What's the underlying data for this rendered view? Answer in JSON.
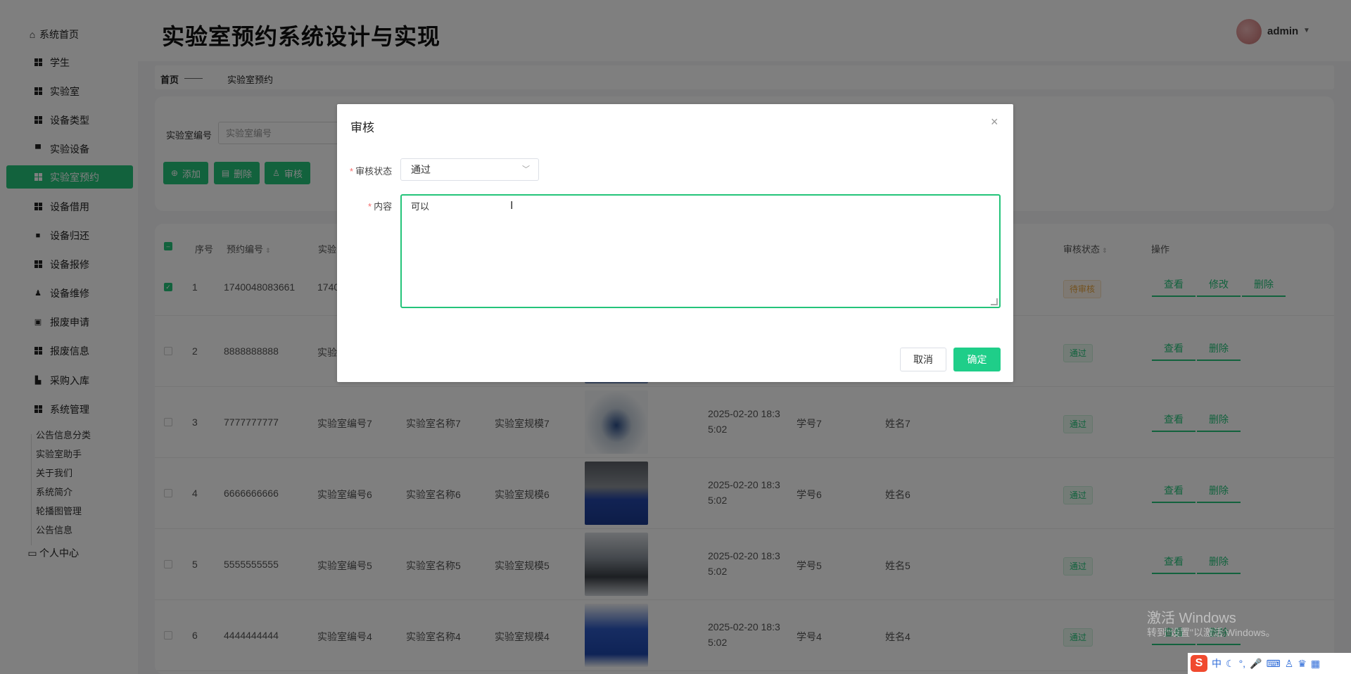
{
  "app": {
    "title": "实验室预约系统设计与实现"
  },
  "user": {
    "name": "admin"
  },
  "sidebar": {
    "home": "系统首页",
    "items": [
      {
        "label": "学生",
        "icon": "grid-icon"
      },
      {
        "label": "实验室",
        "icon": "grid-icon"
      },
      {
        "label": "设备类型",
        "icon": "grid-icon"
      },
      {
        "label": "实验设备",
        "icon": "monitor-icon"
      },
      {
        "label": "实验室预约",
        "icon": "grid-icon",
        "active": true
      },
      {
        "label": "设备借用",
        "icon": "grid-icon"
      },
      {
        "label": "设备归还",
        "icon": "briefcase-icon"
      },
      {
        "label": "设备报修",
        "icon": "grid-icon"
      },
      {
        "label": "设备维修",
        "icon": "person-icon"
      },
      {
        "label": "报废申请",
        "icon": "clipboard-icon"
      },
      {
        "label": "报废信息",
        "icon": "grid-icon"
      },
      {
        "label": "采购入库",
        "icon": "cart-icon"
      },
      {
        "label": "系统管理",
        "icon": "grid-icon"
      }
    ],
    "sub_items": [
      "公告信息分类",
      "实验室助手",
      "关于我们",
      "系统简介",
      "轮播图管理",
      "公告信息"
    ],
    "personal": "个人中心"
  },
  "breadcrumb": {
    "home": "首页",
    "separator": "——",
    "current": "实验室预约"
  },
  "search": {
    "label": "实验室编号",
    "placeholder": "实验室编号"
  },
  "toolbar": {
    "add": "添加",
    "delete": "删除",
    "review": "审核"
  },
  "table": {
    "headers": {
      "index": "序号",
      "booking_no": "预约编号",
      "lab_no": "实验",
      "review_status": "审核状态",
      "actions": "操作"
    },
    "rows": [
      {
        "index": "1",
        "booking_no": "1740048083661",
        "lab_no": "1740",
        "status": "待审核",
        "checked": true
      },
      {
        "index": "2",
        "booking_no": "8888888888",
        "lab_no": "实验",
        "status": "通过"
      },
      {
        "index": "3",
        "booking_no": "7777777777",
        "lab_no": "实验室编号7",
        "lab_name": "实验室名称7",
        "lab_spec": "实验室规模7",
        "date1": "2025-02-20 18:3",
        "date2": "5:02",
        "student_no": "学号7",
        "student_name": "姓名7",
        "status": "通过"
      },
      {
        "index": "4",
        "booking_no": "6666666666",
        "lab_no": "实验室编号6",
        "lab_name": "实验室名称6",
        "lab_spec": "实验室规模6",
        "date1": "2025-02-20 18:3",
        "date2": "5:02",
        "student_no": "学号6",
        "student_name": "姓名6",
        "status": "通过"
      },
      {
        "index": "5",
        "booking_no": "5555555555",
        "lab_no": "实验室编号5",
        "lab_name": "实验室名称5",
        "lab_spec": "实验室规模5",
        "date1": "2025-02-20 18:3",
        "date2": "5:02",
        "student_no": "学号5",
        "student_name": "姓名5",
        "status": "通过"
      },
      {
        "index": "6",
        "booking_no": "4444444444",
        "lab_no": "实验室编号4",
        "lab_name": "实验室名称4",
        "lab_spec": "实验室规模4",
        "date1": "2025-02-20 18:3",
        "date2": "5:02",
        "student_no": "学号4",
        "student_name": "姓名4",
        "status": "通过"
      }
    ],
    "actions": {
      "view": "查看",
      "edit": "修改",
      "delete": "删除"
    }
  },
  "dialog": {
    "title": "审核",
    "status_label": "审核状态",
    "status_value": "通过",
    "content_label": "内容",
    "content_value": "可以",
    "cancel": "取消",
    "confirm": "确定"
  },
  "watermark": {
    "line1": "激活 Windows",
    "line2": "转到\"设置\"以激活 Windows。"
  },
  "ime": {
    "logo": "S",
    "mode": "中"
  },
  "colors": {
    "accent": "#24c47a",
    "confirm_button": "#1fce89",
    "pending": "#e6a23c",
    "required": "#f56c6c"
  }
}
